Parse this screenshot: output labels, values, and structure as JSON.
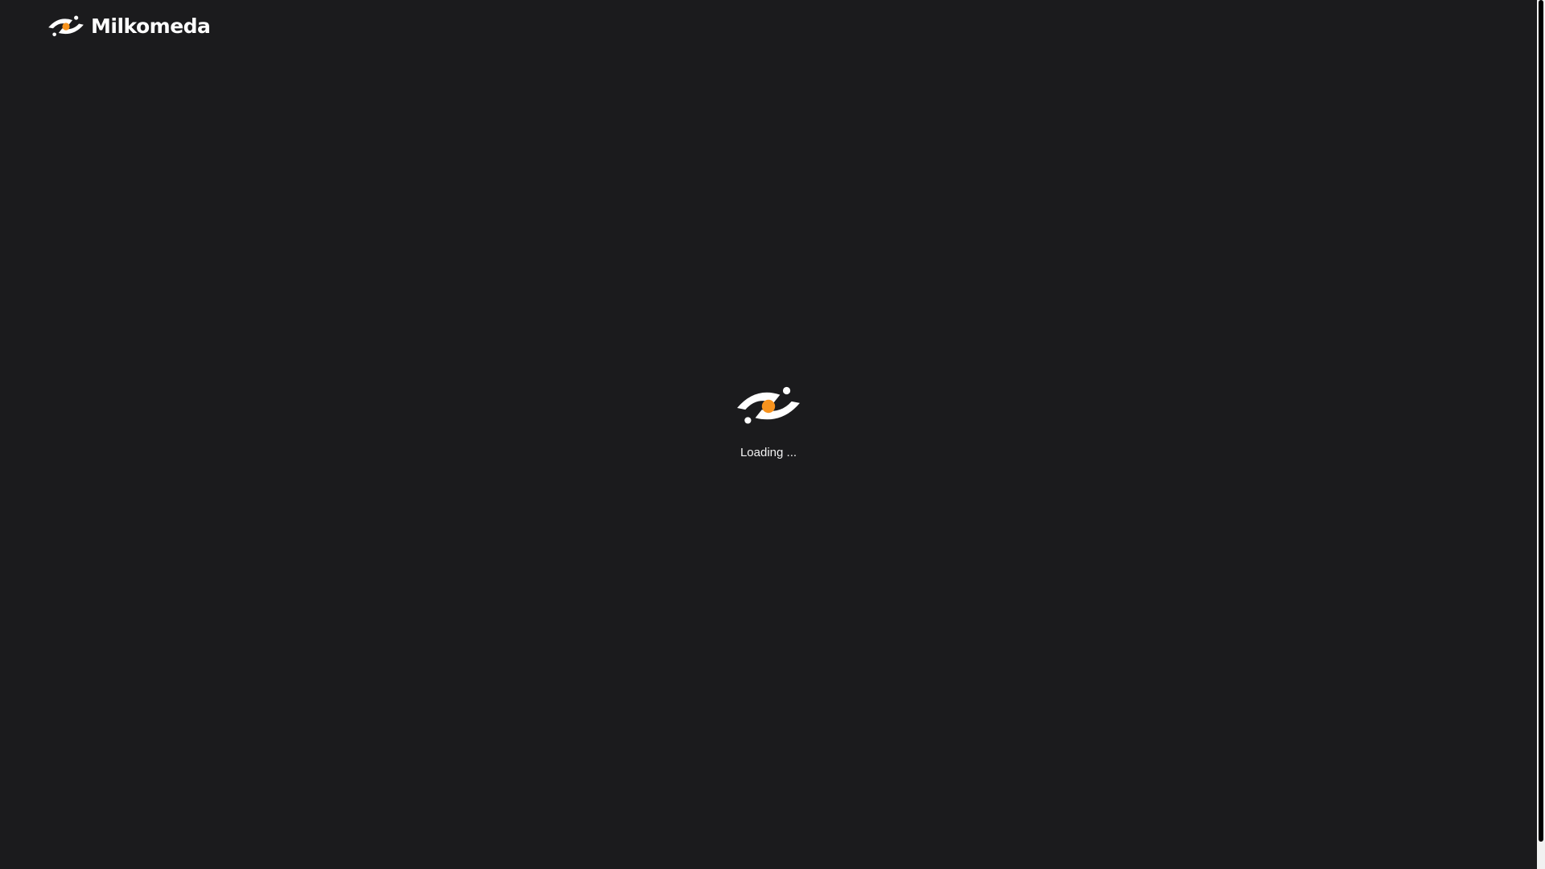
{
  "header": {
    "brand_name": "Milkomeda",
    "logo_icon": "milkomeda-logo-icon"
  },
  "loading": {
    "icon": "milkomeda-logo-icon",
    "text": "Loading ..."
  },
  "colors": {
    "background": "#1b1b1d",
    "logo_white": "#ffffff",
    "accent_orange": "#f7931e",
    "scrollbar_track": "#f1f1f1",
    "scrollbar_thumb": "#000000"
  },
  "scroll": {
    "thumb_fraction": 0.97
  }
}
